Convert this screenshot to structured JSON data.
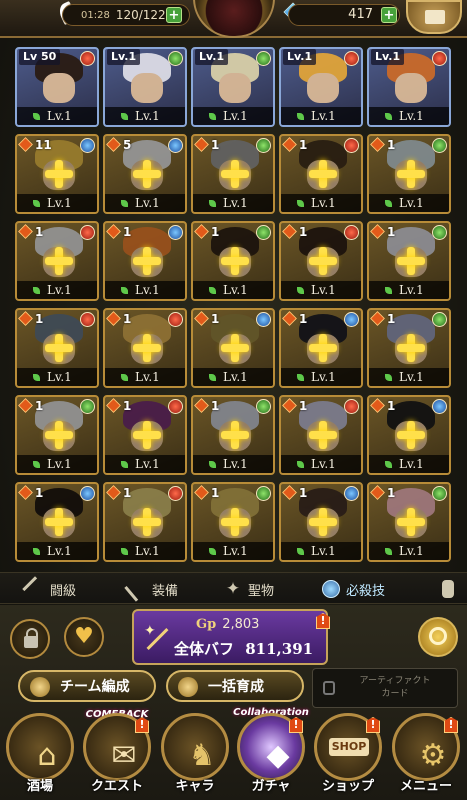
{
  "topbar": {
    "time": "01:28",
    "stamina": "120/122",
    "gems": "417"
  },
  "roster": {
    "owned": [
      {
        "level": "Lv 50",
        "lv_label": "Lv.1",
        "hair": "#2a1c14",
        "type": "red"
      },
      {
        "level": "Lv.1",
        "lv_label": "Lv.1",
        "hair": "#dcdce6",
        "type": "green"
      },
      {
        "level": "Lv.1",
        "lv_label": "Lv.1",
        "hair": "#d8cfa8",
        "type": "green"
      },
      {
        "level": "Lv.1",
        "lv_label": "Lv.1",
        "hair": "#e0a43a",
        "type": "red"
      },
      {
        "level": "Lv.1",
        "lv_label": "Lv.1",
        "hair": "#c96a2a",
        "type": "red"
      }
    ],
    "locked_rows": [
      [
        {
          "num": "11",
          "lv_label": "Lv.1",
          "hair": "#d8b040",
          "type": "blue"
        },
        {
          "num": "5",
          "lv_label": "Lv.1",
          "hair": "#d4d4d4",
          "type": "blue"
        },
        {
          "num": "1",
          "lv_label": "Lv.1",
          "hair": "#8a8a8a",
          "type": "green"
        },
        {
          "num": "1",
          "lv_label": "Lv.1",
          "hair": "#3a2b1a",
          "type": "red"
        },
        {
          "num": "1",
          "lv_label": "Lv.1",
          "hair": "#b6c4c8",
          "type": "green"
        }
      ],
      [
        {
          "num": "1",
          "lv_label": "Lv.1",
          "hair": "#d0d0d0",
          "type": "red"
        },
        {
          "num": "1",
          "lv_label": "Lv.1",
          "hair": "#d8742a",
          "type": "blue"
        },
        {
          "num": "1",
          "lv_label": "Lv.1",
          "hair": "#2a1e14",
          "type": "green"
        },
        {
          "num": "1",
          "lv_label": "Lv.1",
          "hair": "#2a1c14",
          "type": "red"
        },
        {
          "num": "1",
          "lv_label": "Lv.1",
          "hair": "#c8c8d0",
          "type": "green"
        }
      ],
      [
        {
          "num": "1",
          "lv_label": "Lv.1",
          "hair": "#5a6a7a",
          "type": "red"
        },
        {
          "num": "1",
          "lv_label": "Lv.1",
          "hair": "#caa04a",
          "type": "red"
        },
        {
          "num": "1",
          "lv_label": "Lv.1",
          "hair": "#8a7a3a",
          "type": "blue"
        },
        {
          "num": "1",
          "lv_label": "Lv.1",
          "hair": "#1a1a22",
          "type": "blue"
        },
        {
          "num": "1",
          "lv_label": "Lv.1",
          "hair": "#8a90b0",
          "type": "green"
        }
      ],
      [
        {
          "num": "1",
          "lv_label": "Lv.1",
          "hair": "#cfcfcf",
          "type": "green"
        },
        {
          "num": "1",
          "lv_label": "Lv.1",
          "hair": "#6a2a6a",
          "type": "red"
        },
        {
          "num": "1",
          "lv_label": "Lv.1",
          "hair": "#b8bcc8",
          "type": "green"
        },
        {
          "num": "1",
          "lv_label": "Lv.1",
          "hair": "#b0b0c8",
          "type": "red"
        },
        {
          "num": "1",
          "lv_label": "Lv.1",
          "hair": "#1a1a1a",
          "type": "blue"
        }
      ],
      [
        {
          "num": "1",
          "lv_label": "Lv.1",
          "hair": "#1a1410",
          "type": "blue"
        },
        {
          "num": "1",
          "lv_label": "Lv.1",
          "hair": "#c4b46a",
          "type": "red"
        },
        {
          "num": "1",
          "lv_label": "Lv.1",
          "hair": "#b8a050",
          "type": "green"
        },
        {
          "num": "1",
          "lv_label": "Lv.1",
          "hair": "#3a2a22",
          "type": "blue"
        },
        {
          "num": "1",
          "lv_label": "Lv.1",
          "hair": "#e0a8b0",
          "type": "green"
        }
      ]
    ]
  },
  "tabs": [
    {
      "label": "闘級",
      "active": false
    },
    {
      "label": "装備",
      "active": false
    },
    {
      "label": "聖物",
      "active": false
    },
    {
      "label": "必殺技",
      "active": true
    }
  ],
  "gp": {
    "prefix": "Gp",
    "value": "2,803",
    "buff_label": "全体バフ",
    "buff_value": "811,391",
    "alert": "!"
  },
  "actions": {
    "team_edit": "チーム編成",
    "bulk_train": "一括育成",
    "artifact_line1": "アーティファクト",
    "artifact_line2": "カード"
  },
  "nav": {
    "items": [
      {
        "label": "酒場",
        "banner": "",
        "alert": false
      },
      {
        "label": "クエスト",
        "banner": "COMEBACK",
        "alert": true
      },
      {
        "label": "キャラ",
        "banner": "",
        "alert": false
      },
      {
        "label": "ガチャ",
        "banner": "Collaboration",
        "alert": true
      },
      {
        "label": "ショップ",
        "banner": "",
        "alert": true
      },
      {
        "label": "メニュー",
        "banner": "",
        "alert": true
      }
    ],
    "shop_sign": "SHOP"
  },
  "colors": {
    "owned_border": "#8aa7d8",
    "locked_border": "#b88c38",
    "gp_panel": "#6a3aa0",
    "alert": "#e04a14"
  }
}
